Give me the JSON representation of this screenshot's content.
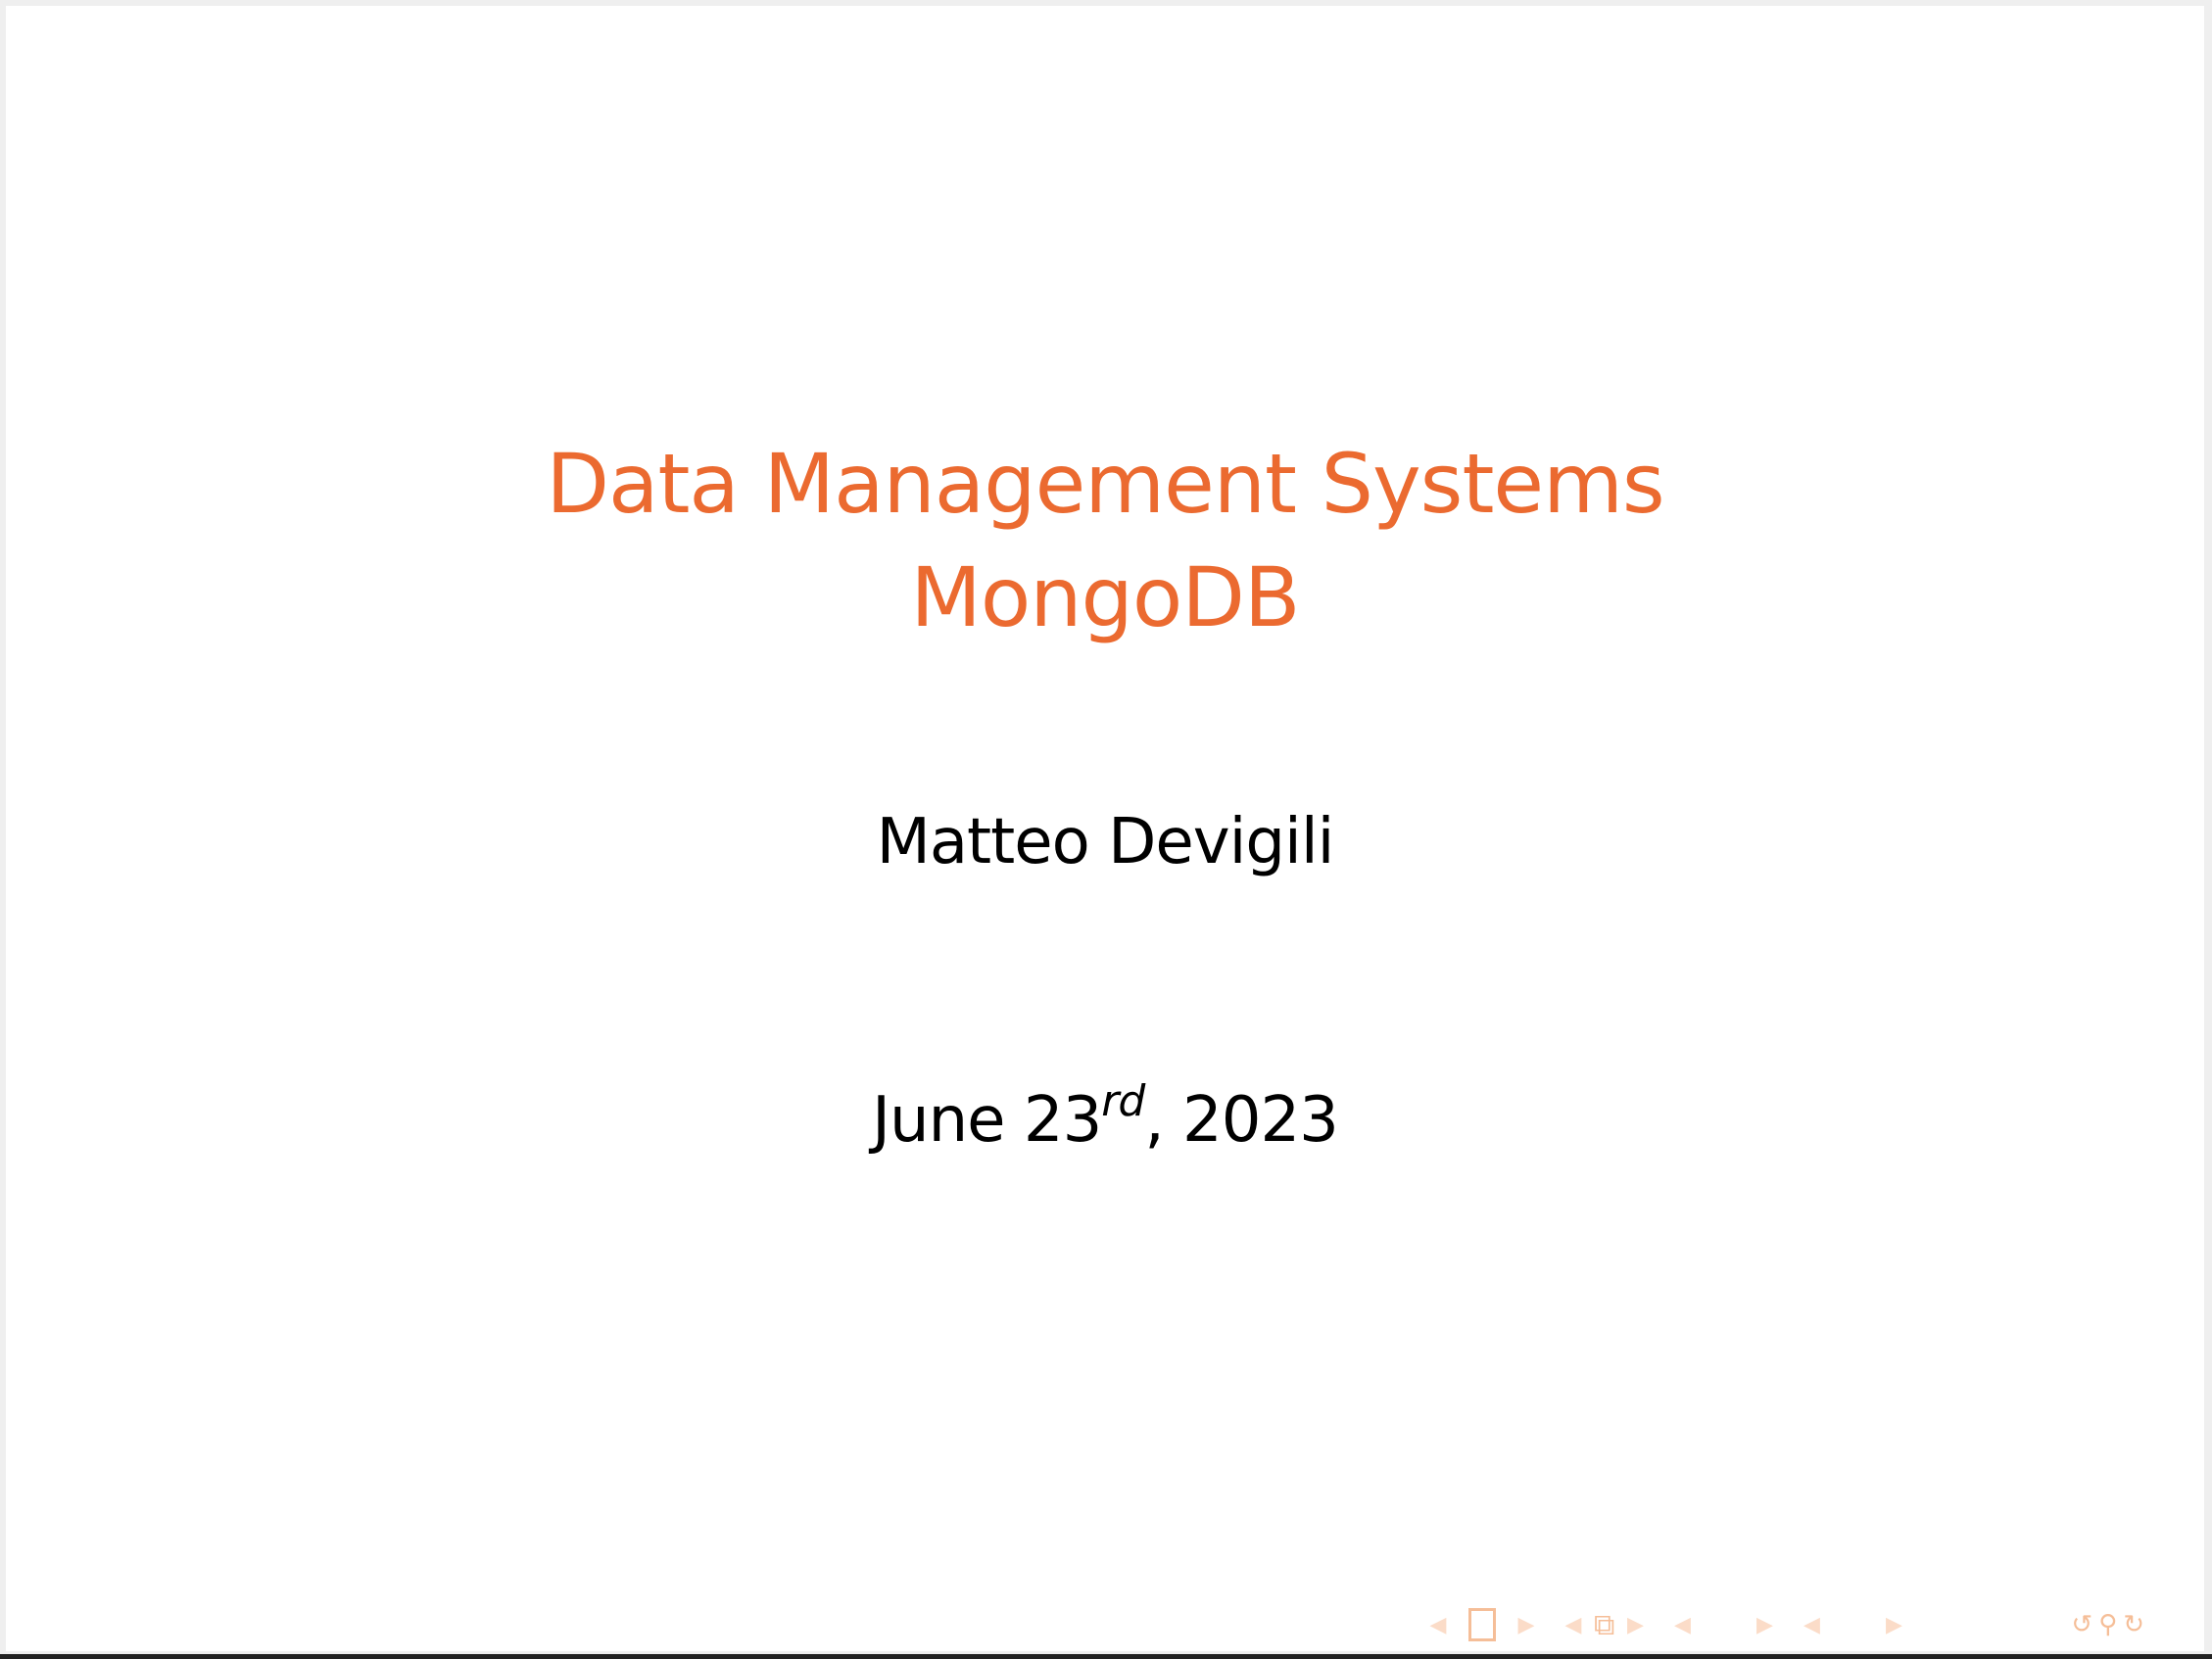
{
  "slide": {
    "title_line1": "Data Management Systems",
    "title_line2": "MongoDB",
    "author": "Matteo Devigili",
    "date_prefix": "June 23",
    "date_superscript": "rd",
    "date_suffix": ", 2023"
  },
  "colors": {
    "title": "#EB6A30",
    "nav_icons": "#F5BE98"
  },
  "navigation": {
    "icons": [
      "prev-slide",
      "slide-frame",
      "next-slide",
      "prev-frame-stack",
      "frame-stack",
      "next-frame-stack",
      "prev-subsection",
      "subsection",
      "next-subsection",
      "prev-section",
      "section",
      "next-section",
      "document",
      "back",
      "search",
      "forward"
    ]
  }
}
